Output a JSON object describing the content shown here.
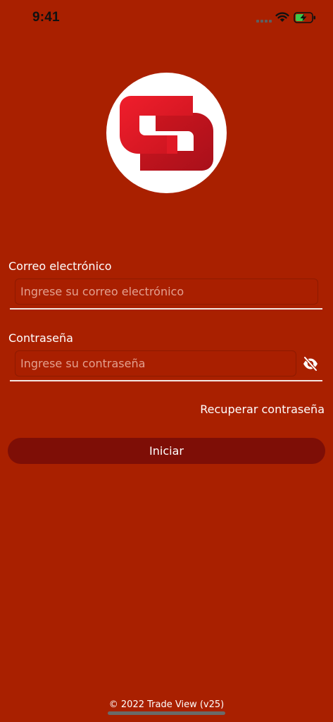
{
  "status_bar": {
    "time": "9:41",
    "icons": [
      "signal-icon",
      "wifi-icon",
      "battery-charging-icon"
    ]
  },
  "logo": {
    "icon": "brand-logo"
  },
  "form": {
    "email_label": "Correo electrónico",
    "email_placeholder": "Ingrese su correo electrónico",
    "email_value": "",
    "password_label": "Contraseña",
    "password_placeholder": "Ingrese su contraseña",
    "password_value": "",
    "password_toggle_icon": "eye-off-icon",
    "recover_link": "Recuperar contraseña",
    "submit_label": "Iniciar"
  },
  "footer": {
    "text": "© 2022 Trade View (v25)"
  },
  "colors": {
    "background": "#A92000",
    "button": "#7E0E06",
    "logo_red": "#E3202E",
    "logo_dark_red": "#B4141E",
    "battery_green": "#3CC84A"
  }
}
